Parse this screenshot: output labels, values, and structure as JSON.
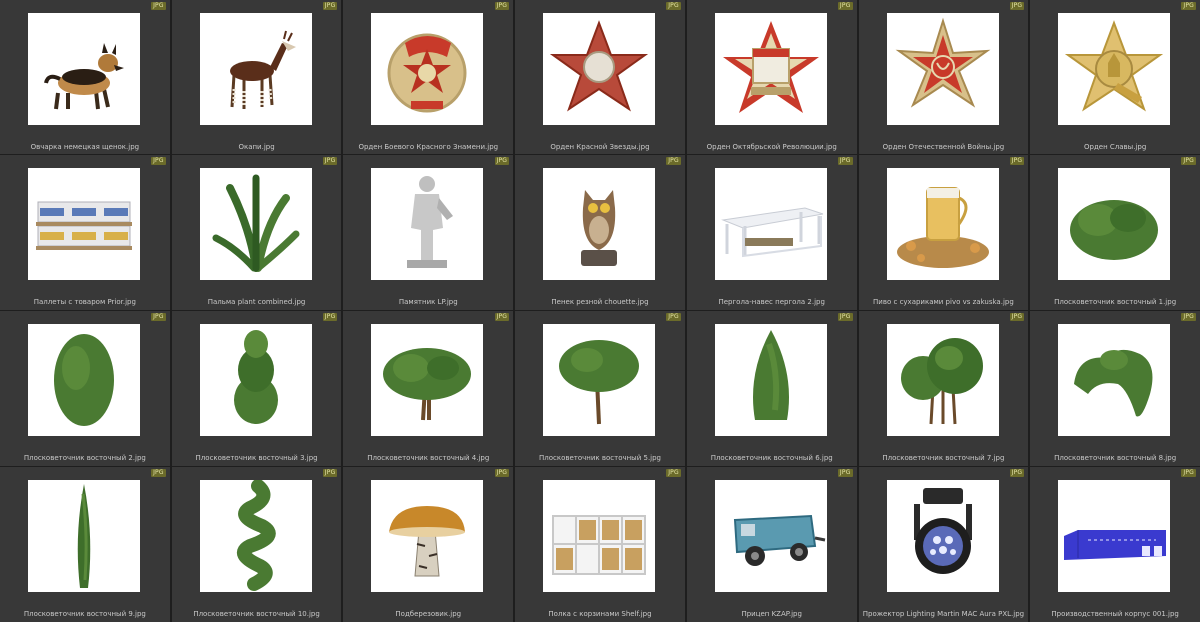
{
  "badge_label": "JPG",
  "items": [
    {
      "name": "Овчарка немецкая щенок.jpg",
      "icon": "dog-icon"
    },
    {
      "name": "Окапи.jpg",
      "icon": "okapi-icon"
    },
    {
      "name": "Орден Боевого Красного Знамени.jpg",
      "icon": "medal-icon"
    },
    {
      "name": "Орден Красной Звезды.jpg",
      "icon": "star-medal-icon"
    },
    {
      "name": "Орден Октябрьской Революции.jpg",
      "icon": "medal-icon"
    },
    {
      "name": "Орден Отечественной Войны.jpg",
      "icon": "star-medal-icon"
    },
    {
      "name": "Орден Славы.jpg",
      "icon": "star-medal-icon"
    },
    {
      "name": "Паллеты с товаром Prior.jpg",
      "icon": "pallets-icon"
    },
    {
      "name": "Пальма plant combined.jpg",
      "icon": "fern-icon"
    },
    {
      "name": "Памятник LP.jpg",
      "icon": "statue-icon"
    },
    {
      "name": "Пенек резной chouette.jpg",
      "icon": "owl-icon"
    },
    {
      "name": "Пергола-навес пергола 2.jpg",
      "icon": "pergola-icon"
    },
    {
      "name": "Пиво с сухариками pivo vs zakuska.jpg",
      "icon": "beer-icon"
    },
    {
      "name": "Плосковеточник восточный 1.jpg",
      "icon": "bush-icon"
    },
    {
      "name": "Плосковеточник восточный 2.jpg",
      "icon": "shrub-icon"
    },
    {
      "name": "Плосковеточник восточный 3.jpg",
      "icon": "shrub-icon"
    },
    {
      "name": "Плосковеточник восточный 4.jpg",
      "icon": "tree-icon"
    },
    {
      "name": "Плосковеточник восточный 5.jpg",
      "icon": "tree-icon"
    },
    {
      "name": "Плосковеточник восточный 6.jpg",
      "icon": "cypress-icon"
    },
    {
      "name": "Плосковеточник восточный 7.jpg",
      "icon": "tree-icon"
    },
    {
      "name": "Плосковеточник восточный 8.jpg",
      "icon": "shrub-icon"
    },
    {
      "name": "Плосковеточник восточный 9.jpg",
      "icon": "column-tree-icon"
    },
    {
      "name": "Плосковеточник восточный 10.jpg",
      "icon": "spiral-tree-icon"
    },
    {
      "name": "Подберезовик.jpg",
      "icon": "mushroom-icon"
    },
    {
      "name": "Полка с корзинами Shelf.jpg",
      "icon": "shelf-icon"
    },
    {
      "name": "Прицеп KZAP.jpg",
      "icon": "trailer-icon"
    },
    {
      "name": "Прожектор Lighting Martin MAC Aura PXL.jpg",
      "icon": "spotlight-icon"
    },
    {
      "name": "Производственный корпус 001.jpg",
      "icon": "building-icon"
    }
  ]
}
